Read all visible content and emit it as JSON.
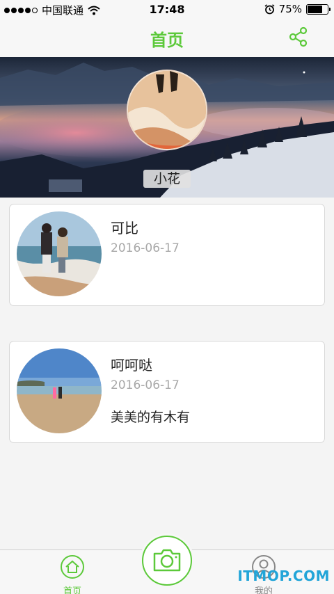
{
  "status_bar": {
    "carrier": "中国联通",
    "time": "17:48",
    "battery_percent": "75%",
    "battery_level": 0.75
  },
  "nav": {
    "title": "首页",
    "share_icon": "share-icon"
  },
  "banner": {
    "name": "小花"
  },
  "posts": [
    {
      "name": "可比",
      "date": "2016-06-17",
      "text": ""
    },
    {
      "name": "呵呵哒",
      "date": "2016-06-17",
      "text": "美美的有木有"
    }
  ],
  "tab_bar": {
    "home_label": "首页",
    "mine_label": "我的",
    "camera_icon": "camera-icon"
  },
  "watermark": "ITMOP.COM",
  "colors": {
    "accent": "#5cc93a",
    "date_gray": "#a8a8a8",
    "watermark": "#22a5d8"
  }
}
